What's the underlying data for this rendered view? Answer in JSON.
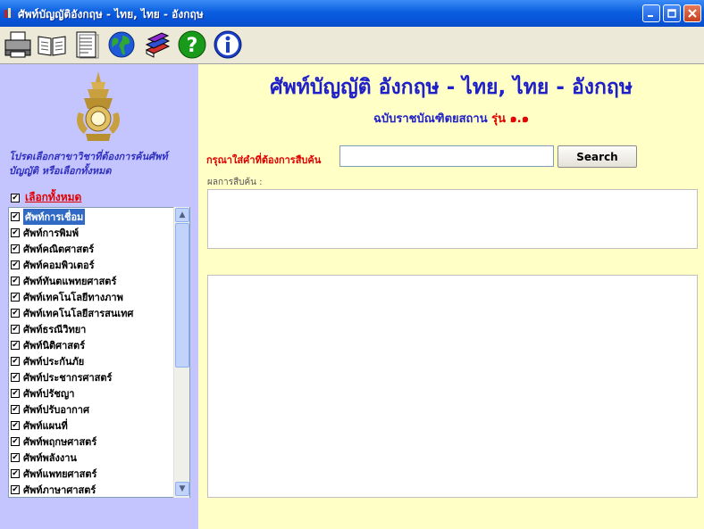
{
  "window": {
    "title": "ศัพท์บัญญัติอังกฤษ - ไทย, ไทย - อังกฤษ",
    "minimize_icon": "minimize-icon",
    "maximize_icon": "maximize-icon",
    "close_icon": "close-icon"
  },
  "toolbar": {
    "buttons": [
      {
        "icon": "printer-icon"
      },
      {
        "icon": "open-book-icon"
      },
      {
        "icon": "document-icon"
      },
      {
        "icon": "globe-icon"
      },
      {
        "icon": "books-icon"
      },
      {
        "icon": "help-icon"
      },
      {
        "icon": "info-icon"
      }
    ]
  },
  "sidebar": {
    "instruction": "โปรดเลือกสาขาวิชาที่ต้องการค้นศัพท์บัญญัติ หรือเลือกทั้งหมด",
    "select_all_label": "เลือกทั้งหมด",
    "select_all_checked": true,
    "items": [
      {
        "label": "ศัพท์การเชื่อม",
        "checked": true,
        "selected": true
      },
      {
        "label": "ศัพท์การพิมพ์",
        "checked": true
      },
      {
        "label": "ศัพท์คณิตศาสตร์",
        "checked": true
      },
      {
        "label": "ศัพท์คอมพิวเตอร์",
        "checked": true
      },
      {
        "label": "ศัพท์ทันตแพทยศาสตร์",
        "checked": true
      },
      {
        "label": "ศัพท์เทคโนโลยีทางภาพ",
        "checked": true
      },
      {
        "label": "ศัพท์เทคโนโลยีสารสนเทศ",
        "checked": true
      },
      {
        "label": "ศัพท์ธรณีวิทยา",
        "checked": true
      },
      {
        "label": "ศัพท์นิติศาสตร์",
        "checked": true
      },
      {
        "label": "ศัพท์ประกันภัย",
        "checked": true
      },
      {
        "label": "ศัพท์ประชากรศาสตร์",
        "checked": true
      },
      {
        "label": "ศัพท์ปรัชญา",
        "checked": true
      },
      {
        "label": "ศัพท์ปรับอากาศ",
        "checked": true
      },
      {
        "label": "ศัพท์แผนที่",
        "checked": true
      },
      {
        "label": "ศัพท์พฤกษศาสตร์",
        "checked": true
      },
      {
        "label": "ศัพท์พลังงาน",
        "checked": true
      },
      {
        "label": "ศัพท์แพทยศาสตร์",
        "checked": true
      },
      {
        "label": "ศัพท์ภาษาศาสตร์",
        "checked": true
      }
    ]
  },
  "main": {
    "heading": "ศัพท์บัญญัติ อังกฤษ - ไทย, ไทย - อังกฤษ",
    "subheading": "ฉบับราชบัณฑิตยสถาน",
    "version": "รุ่น ๑.๑",
    "search_prompt": "กรุณาใส่คำที่ต้องการสืบค้น",
    "search_value": "",
    "search_button": "Search",
    "results_label": "ผลการสืบค้น :"
  },
  "colors": {
    "sidebar_bg": "#c4c4ff",
    "main_bg": "#ffffc6",
    "heading": "#2020c8",
    "accent_red": "#e00000",
    "selection": "#316ac5"
  }
}
